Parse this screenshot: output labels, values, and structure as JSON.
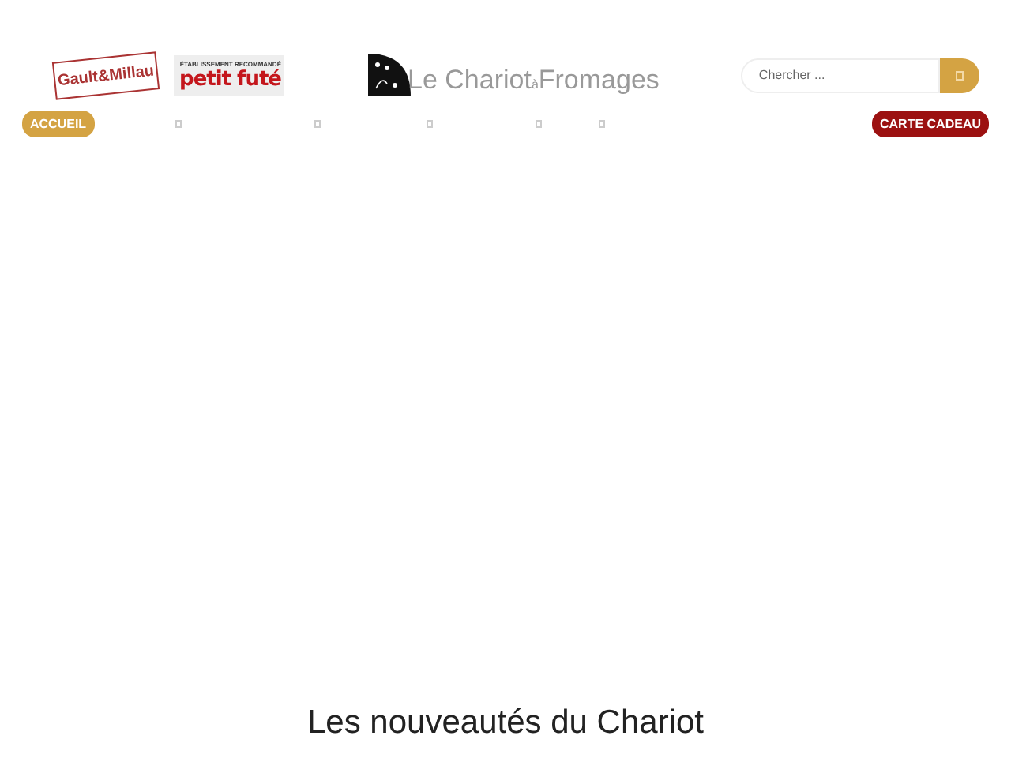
{
  "header": {
    "badges": [
      {
        "kind": "gault",
        "title": "Gault&Millau"
      },
      {
        "kind": "futé",
        "top": "ÉTABLISSEMENT RECOMMANDÉ",
        "title": "petit futé"
      }
    ],
    "logo": {
      "name": "Le Chariot",
      "small": "à",
      "rest": "Fromages"
    },
    "search": {
      "placeholder": "Chercher ..."
    }
  },
  "nav": {
    "home": "ACCUEIL",
    "gift": "CARTE CADEAU"
  },
  "section": {
    "title": "Les nouveautés du Chariot"
  }
}
